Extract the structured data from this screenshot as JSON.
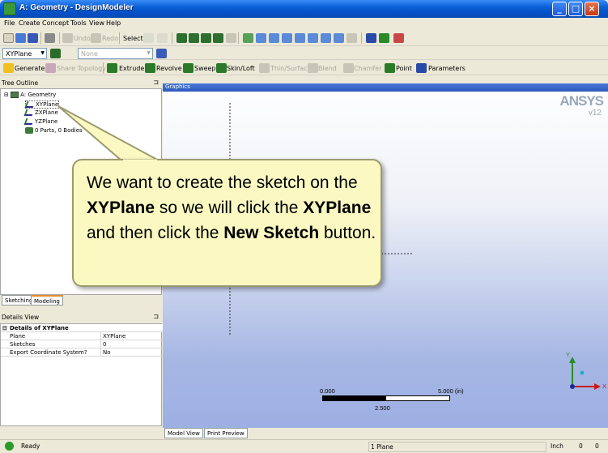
{
  "window": {
    "title": "A: Geometry - DesignModeler",
    "min": "_",
    "max": "□",
    "close": "×"
  },
  "menu": [
    "File",
    "Create",
    "Concept",
    "Tools",
    "View",
    "Help"
  ],
  "toolbar1": {
    "undo": "Undo",
    "redo": "Redo",
    "select": "Select:"
  },
  "toolbar2": {
    "plane_select": "XYPlane",
    "sketch_select": "None"
  },
  "toolbar3": {
    "generate": "Generate",
    "share_topology": "Share Topology",
    "extrude": "Extrude",
    "revolve": "Revolve",
    "sweep": "Sweep",
    "skin_loft": "Skin/Loft",
    "thin_surface": "Thin/Surface",
    "blend": "Blend",
    "chamfer": "Chamfer",
    "point": "Point",
    "parameters": "Parameters"
  },
  "tree": {
    "header": "Tree Outline",
    "root": "A: Geometry",
    "items": [
      "XYPlane",
      "ZXPlane",
      "YZPlane",
      "0 Parts, 0 Bodies"
    ]
  },
  "tabs": {
    "sketching": "Sketching",
    "modeling": "Modeling"
  },
  "details": {
    "header": "Details View",
    "group": "Details of XYPlane",
    "rows": [
      {
        "label": "Plane",
        "value": "XYPlane"
      },
      {
        "label": "Sketches",
        "value": "0"
      },
      {
        "label": "Export Coordinate System?",
        "value": "No"
      }
    ]
  },
  "graphics": {
    "header": "Graphics",
    "logo": "ANSYS",
    "version": "v12",
    "scale_left": "0.000",
    "scale_right": "5.000 (in)",
    "scale_mid": "2.500",
    "axis_y": "Y",
    "axis_x": "X"
  },
  "graphics_tabs": {
    "model_view": "Model View",
    "print_preview": "Print Preview"
  },
  "status": {
    "ready": "Ready",
    "selection": "1 Plane",
    "units": "Inch",
    "v1": "0",
    "v2": "0"
  },
  "callout": {
    "p1": "We want to create the sketch on the ",
    "b1": "XYPlane",
    "p2": " so we will click the ",
    "b2": "XYPlane",
    "p3": " and then click the ",
    "b3": "New Sketch",
    "p4": " button."
  }
}
